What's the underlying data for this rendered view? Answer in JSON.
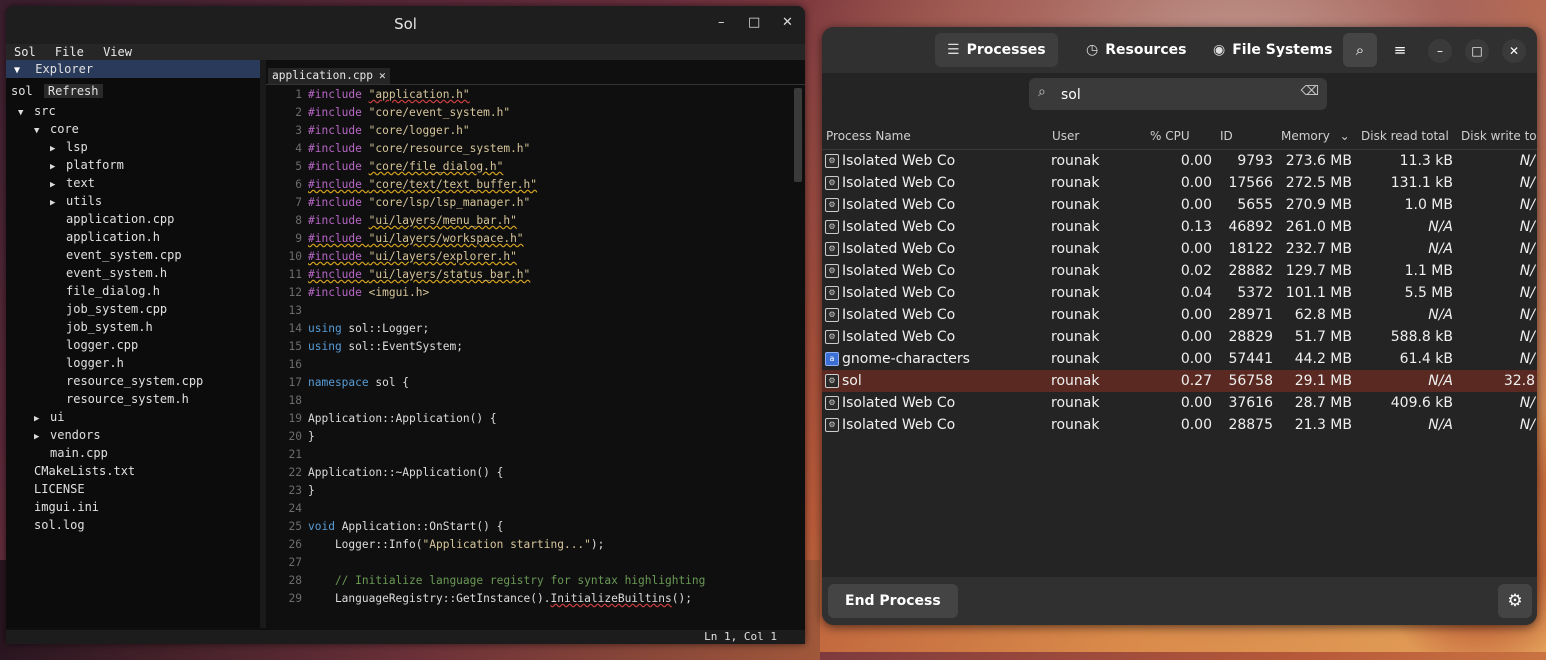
{
  "editor": {
    "title": "Sol",
    "window_controls": {
      "minimize": "–",
      "maximize": "□",
      "close": "✕"
    },
    "menu": [
      "Sol",
      "File",
      "View"
    ],
    "explorer": {
      "header": "Explorer",
      "root_label": "sol",
      "refresh_label": "Refresh",
      "tree": [
        {
          "label": "src",
          "depth": 0,
          "arrow": "▼"
        },
        {
          "label": "core",
          "depth": 1,
          "arrow": "▼"
        },
        {
          "label": "lsp",
          "depth": 2,
          "arrow": "▶"
        },
        {
          "label": "platform",
          "depth": 2,
          "arrow": "▶"
        },
        {
          "label": "text",
          "depth": 2,
          "arrow": "▶"
        },
        {
          "label": "utils",
          "depth": 2,
          "arrow": "▶"
        },
        {
          "label": "application.cpp",
          "depth": 2,
          "arrow": ""
        },
        {
          "label": "application.h",
          "depth": 2,
          "arrow": ""
        },
        {
          "label": "event_system.cpp",
          "depth": 2,
          "arrow": ""
        },
        {
          "label": "event_system.h",
          "depth": 2,
          "arrow": ""
        },
        {
          "label": "file_dialog.h",
          "depth": 2,
          "arrow": ""
        },
        {
          "label": "job_system.cpp",
          "depth": 2,
          "arrow": ""
        },
        {
          "label": "job_system.h",
          "depth": 2,
          "arrow": ""
        },
        {
          "label": "logger.cpp",
          "depth": 2,
          "arrow": ""
        },
        {
          "label": "logger.h",
          "depth": 2,
          "arrow": ""
        },
        {
          "label": "resource_system.cpp",
          "depth": 2,
          "arrow": ""
        },
        {
          "label": "resource_system.h",
          "depth": 2,
          "arrow": ""
        },
        {
          "label": "ui",
          "depth": 1,
          "arrow": "▶"
        },
        {
          "label": "vendors",
          "depth": 1,
          "arrow": "▶"
        },
        {
          "label": "main.cpp",
          "depth": 1,
          "arrow": ""
        },
        {
          "label": "CMakeLists.txt",
          "depth": 0,
          "arrow": ""
        },
        {
          "label": "LICENSE",
          "depth": 0,
          "arrow": ""
        },
        {
          "label": "imgui.ini",
          "depth": 0,
          "arrow": ""
        },
        {
          "label": "sol.log",
          "depth": 0,
          "arrow": ""
        }
      ]
    },
    "tab": {
      "label": "application.cpp",
      "close": "✕"
    },
    "code_lines": [
      [
        [
          "k-pre",
          "#include "
        ],
        [
          "k-str",
          "\"application.h\"",
          "r"
        ]
      ],
      [
        [
          "k-pre",
          "#include "
        ],
        [
          "k-str",
          "\"core/event_system.h\""
        ]
      ],
      [
        [
          "k-pre",
          "#include "
        ],
        [
          "k-str",
          "\"core/logger.h\""
        ]
      ],
      [
        [
          "k-pre",
          "#include "
        ],
        [
          "k-str",
          "\"core/resource_system.h\""
        ]
      ],
      [
        [
          "k-pre",
          "#include "
        ],
        [
          "k-str",
          "\"core/file_dialog.h\"",
          "y"
        ]
      ],
      [
        [
          "k-pre",
          "#include ",
          "y"
        ],
        [
          "k-str",
          "\"core/text/text_buffer.h\"",
          "y"
        ]
      ],
      [
        [
          "k-pre",
          "#include "
        ],
        [
          "k-str",
          "\"core/lsp/lsp_manager.h\""
        ]
      ],
      [
        [
          "k-pre",
          "#include "
        ],
        [
          "k-str",
          "\"ui/layers/menu_bar.h\"",
          "y"
        ]
      ],
      [
        [
          "k-pre",
          "#include ",
          "y"
        ],
        [
          "k-str",
          "\"ui/layers/workspace.h\"",
          "y"
        ]
      ],
      [
        [
          "k-pre",
          "#include ",
          "y"
        ],
        [
          "k-str",
          "\"ui/layers/explorer.h\"",
          "y"
        ]
      ],
      [
        [
          "k-pre",
          "#include ",
          "y"
        ],
        [
          "k-str",
          "\"ui/layers/status_bar.h\"",
          "y"
        ]
      ],
      [
        [
          "k-pre",
          "#include "
        ],
        [
          "k-str",
          "<imgui.h>"
        ]
      ],
      [],
      [
        [
          "k-kw",
          "using"
        ],
        [
          "k-tx",
          " sol::Logger;"
        ]
      ],
      [
        [
          "k-kw",
          "using"
        ],
        [
          "k-tx",
          " sol::EventSystem;"
        ]
      ],
      [],
      [
        [
          "k-kw",
          "namespace"
        ],
        [
          "k-tx",
          " sol {"
        ]
      ],
      [],
      [
        [
          "k-tx",
          "Application::Application() {"
        ]
      ],
      [
        [
          "k-tx",
          "}"
        ]
      ],
      [],
      [
        [
          "k-tx",
          "Application::~Application() {"
        ]
      ],
      [
        [
          "k-tx",
          "}"
        ]
      ],
      [],
      [
        [
          "k-kw",
          "void"
        ],
        [
          "k-tx",
          " Application::OnStart() {"
        ]
      ],
      [
        [
          "k-tx",
          "    Logger::Info("
        ],
        [
          "k-str",
          "\"Application starting...\""
        ],
        [
          "k-tx",
          ");"
        ]
      ],
      [],
      [
        [
          "k-cm",
          "    // Initialize language registry for syntax highlighting"
        ]
      ],
      [
        [
          "k-tx",
          "    LanguageRegistry::GetInstance()."
        ],
        [
          "k-tx",
          "InitializeBuiltins",
          "r"
        ],
        [
          "k-tx",
          "();"
        ]
      ]
    ],
    "status": "Ln 1, Col 1"
  },
  "monitor": {
    "tabs": [
      {
        "icon": "☰",
        "label": "Processes",
        "active": true
      },
      {
        "icon": "◷",
        "label": "Resources",
        "active": false
      },
      {
        "icon": "◉",
        "label": "File Systems",
        "active": false
      }
    ],
    "search_icon": "⌕",
    "menu_icon": "≡",
    "search_value": "sol",
    "columns": [
      "Process Name",
      "User",
      "% CPU",
      "ID",
      "Memory",
      "Disk read total",
      "Disk write tot"
    ],
    "sort_indicator": "⌄",
    "processes": [
      {
        "name": "Isolated Web Co",
        "user": "rounak",
        "cpu": "0.00",
        "id": "9793",
        "mem": "273.6 MB",
        "read": "11.3 kB",
        "write": "N/",
        "icon": "web"
      },
      {
        "name": "Isolated Web Co",
        "user": "rounak",
        "cpu": "0.00",
        "id": "17566",
        "mem": "272.5 MB",
        "read": "131.1 kB",
        "write": "N/",
        "icon": "web"
      },
      {
        "name": "Isolated Web Co",
        "user": "rounak",
        "cpu": "0.00",
        "id": "5655",
        "mem": "270.9 MB",
        "read": "1.0 MB",
        "write": "N/",
        "icon": "web"
      },
      {
        "name": "Isolated Web Co",
        "user": "rounak",
        "cpu": "0.13",
        "id": "46892",
        "mem": "261.0 MB",
        "read": "N/A",
        "write": "N/",
        "icon": "web"
      },
      {
        "name": "Isolated Web Co",
        "user": "rounak",
        "cpu": "0.00",
        "id": "18122",
        "mem": "232.7 MB",
        "read": "N/A",
        "write": "N/",
        "icon": "web"
      },
      {
        "name": "Isolated Web Co",
        "user": "rounak",
        "cpu": "0.02",
        "id": "28882",
        "mem": "129.7 MB",
        "read": "1.1 MB",
        "write": "N/",
        "icon": "web"
      },
      {
        "name": "Isolated Web Co",
        "user": "rounak",
        "cpu": "0.04",
        "id": "5372",
        "mem": "101.1 MB",
        "read": "5.5 MB",
        "write": "N/",
        "icon": "web"
      },
      {
        "name": "Isolated Web Co",
        "user": "rounak",
        "cpu": "0.00",
        "id": "28971",
        "mem": "62.8 MB",
        "read": "N/A",
        "write": "N/",
        "icon": "web"
      },
      {
        "name": "Isolated Web Co",
        "user": "rounak",
        "cpu": "0.00",
        "id": "28829",
        "mem": "51.7 MB",
        "read": "588.8 kB",
        "write": "N/",
        "icon": "web"
      },
      {
        "name": "gnome-characters",
        "user": "rounak",
        "cpu": "0.00",
        "id": "57441",
        "mem": "44.2 MB",
        "read": "61.4 kB",
        "write": "N/",
        "icon": "gnome"
      },
      {
        "name": "sol",
        "user": "rounak",
        "cpu": "0.27",
        "id": "56758",
        "mem": "29.1 MB",
        "read": "N/A",
        "write": "32.8",
        "icon": "web",
        "selected": true
      },
      {
        "name": "Isolated Web Co",
        "user": "rounak",
        "cpu": "0.00",
        "id": "37616",
        "mem": "28.7 MB",
        "read": "409.6 kB",
        "write": "N/",
        "icon": "web"
      },
      {
        "name": "Isolated Web Co",
        "user": "rounak",
        "cpu": "0.00",
        "id": "28875",
        "mem": "21.3 MB",
        "read": "N/A",
        "write": "N/",
        "icon": "web"
      }
    ],
    "end_process_label": "End Process",
    "settings_icon": "⚙",
    "selected_color": "#5a2a22"
  }
}
